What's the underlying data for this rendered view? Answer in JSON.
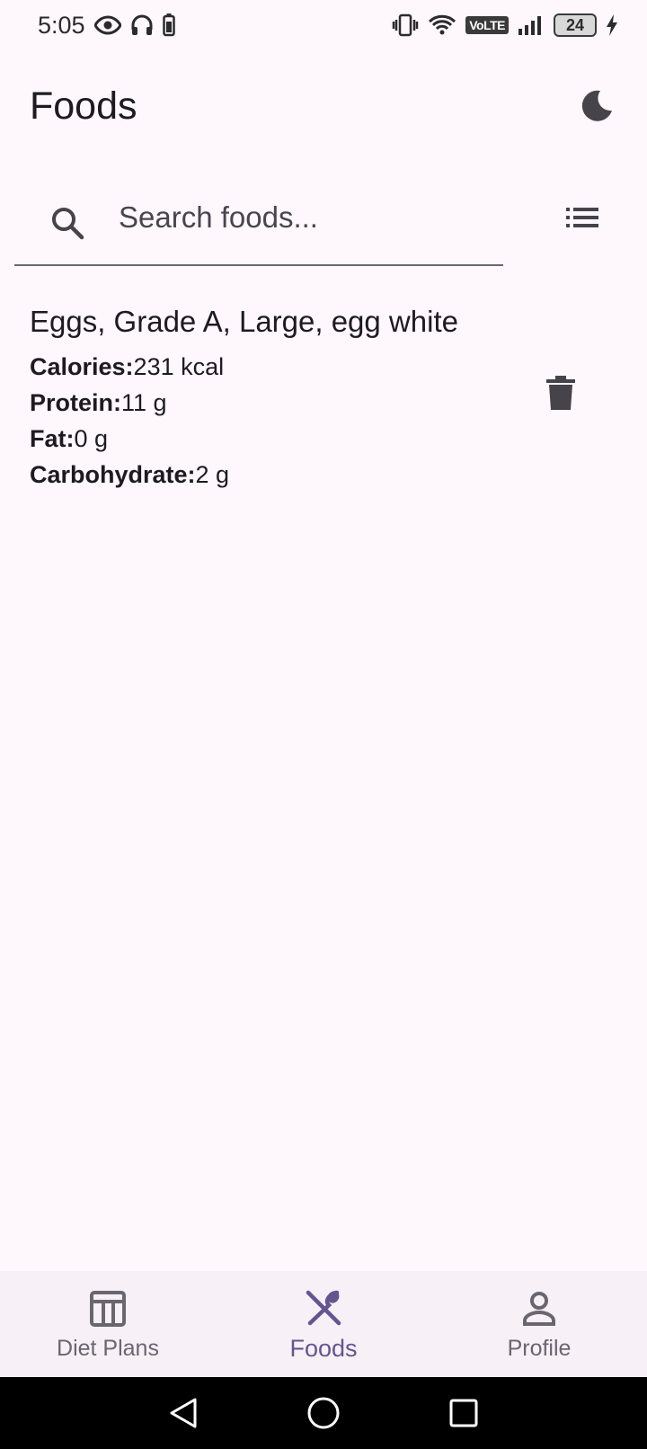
{
  "status_bar": {
    "time": "5:05",
    "network_badge": "VoLTE",
    "battery_level": "24",
    "icons": [
      "eye-icon",
      "headphones-icon",
      "battery-small-icon",
      "vibrate-icon",
      "wifi-icon",
      "signal-icon",
      "charging-icon"
    ]
  },
  "app_bar": {
    "title": "Foods",
    "theme_toggle_icon": "moon-icon"
  },
  "search": {
    "placeholder": "Search foods...",
    "value": "",
    "search_icon": "search-icon",
    "list_icon": "list-icon"
  },
  "foods": [
    {
      "name": "Eggs, Grade A, Large, egg white",
      "calories_label": "Calories:",
      "calories_value": "231 kcal",
      "protein_label": "Protein:",
      "protein_value": "11 g",
      "fat_label": "Fat:",
      "fat_value": "0 g",
      "carb_label": "Carbohydrate:",
      "carb_value": "2 g",
      "action_icon": "trash-icon"
    }
  ],
  "bottom_nav": {
    "items": [
      {
        "label": "Diet Plans",
        "icon": "calendar-table-icon",
        "active": false
      },
      {
        "label": "Foods",
        "icon": "utensils-icon",
        "active": true
      },
      {
        "label": "Profile",
        "icon": "person-icon",
        "active": false
      }
    ]
  },
  "system_nav": {
    "icons": [
      "back-icon",
      "home-icon",
      "recents-icon"
    ]
  },
  "colors": {
    "background": "#fef7fc",
    "primary": "#65558f",
    "nav_background": "#f7f0f7",
    "text": "#1d1b20",
    "icon": "#46434b"
  }
}
